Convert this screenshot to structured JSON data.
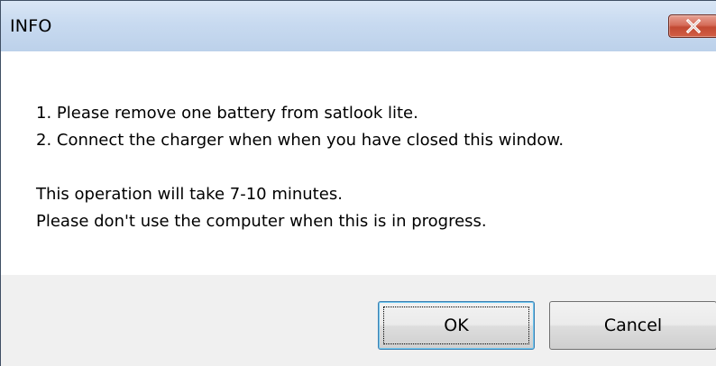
{
  "window": {
    "title": "INFO",
    "close_icon": "close-x-icon"
  },
  "message": {
    "lines": [
      "1. Please remove one battery from satlook lite.",
      "2. Connect the charger when when you have closed this window.",
      "This operation will take 7-10 minutes.",
      "Please don't use the computer when this is in progress."
    ]
  },
  "buttons": {
    "ok_label": "OK",
    "cancel_label": "Cancel"
  },
  "colors": {
    "titlebar": "#c8daf0",
    "close_button": "#c24a33",
    "footer": "#f0f0f0"
  }
}
